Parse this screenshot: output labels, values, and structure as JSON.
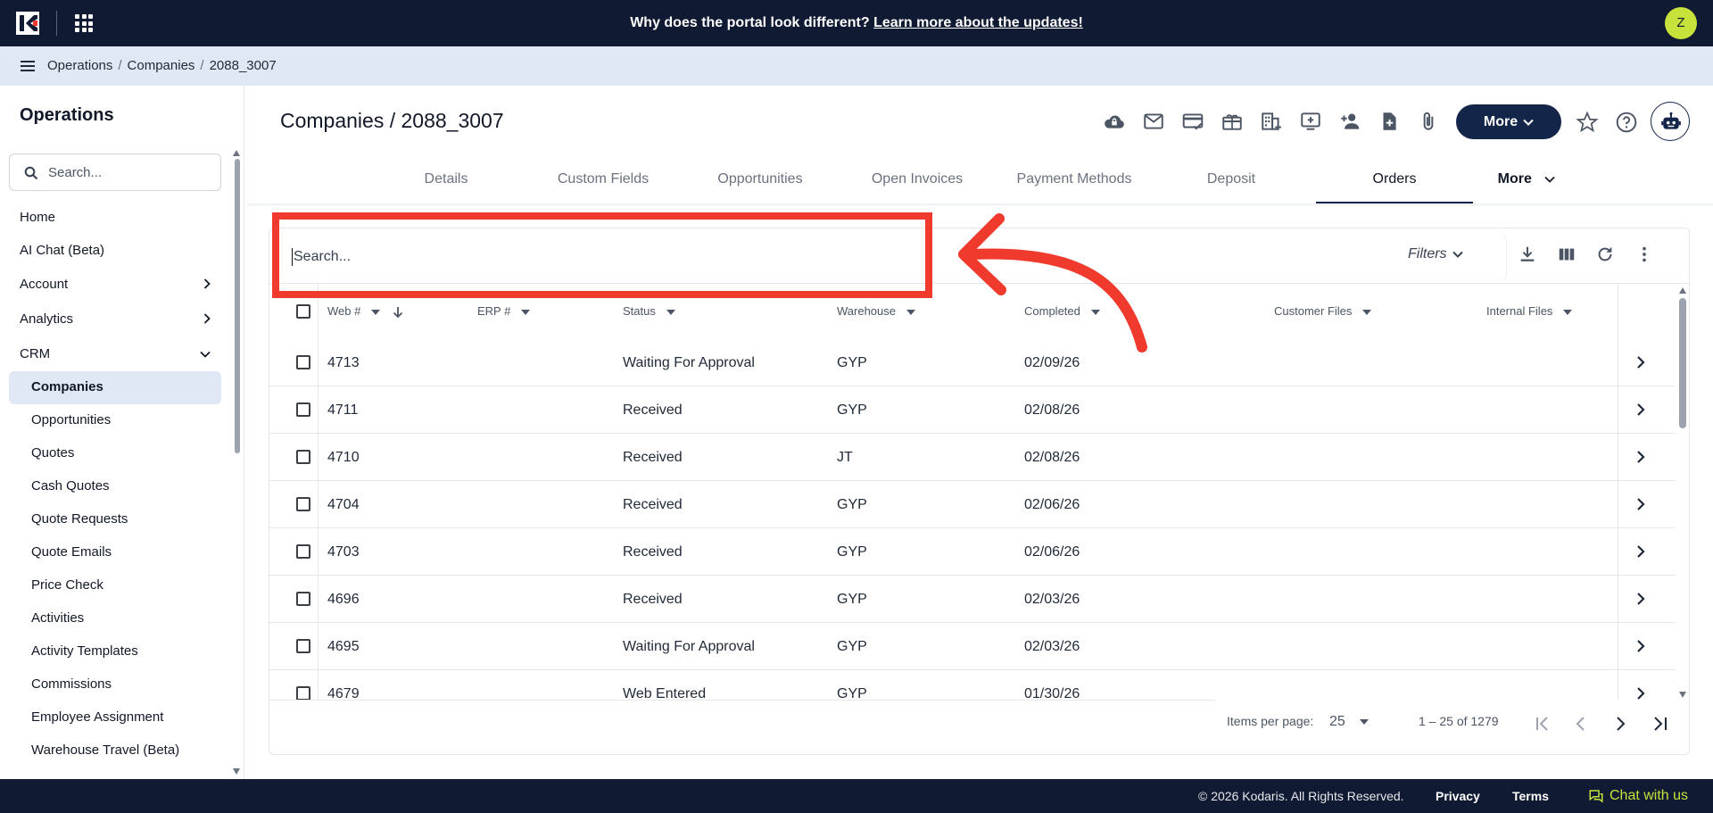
{
  "banner": {
    "question": "Why does the portal look different?",
    "link": "Learn more about the updates!"
  },
  "user": {
    "initial": "Z"
  },
  "breadcrumb": [
    "Operations",
    "Companies",
    "2088_3007"
  ],
  "sidebar": {
    "title": "Operations",
    "search_placeholder": "Search...",
    "items": [
      {
        "label": "Home"
      },
      {
        "label": "AI Chat (Beta)"
      },
      {
        "label": "Account",
        "chevron": "right"
      },
      {
        "label": "Analytics",
        "chevron": "right"
      },
      {
        "label": "CRM",
        "chevron": "down"
      }
    ],
    "crm_items": [
      {
        "label": "Companies",
        "active": true
      },
      {
        "label": "Opportunities"
      },
      {
        "label": "Quotes"
      },
      {
        "label": "Cash Quotes"
      },
      {
        "label": "Quote Requests"
      },
      {
        "label": "Quote Emails"
      },
      {
        "label": "Price Check"
      },
      {
        "label": "Activities"
      },
      {
        "label": "Activity Templates"
      },
      {
        "label": "Commissions"
      },
      {
        "label": "Employee Assignment"
      },
      {
        "label": "Warehouse Travel (Beta)"
      }
    ]
  },
  "page": {
    "title": "Companies / 2088_3007",
    "more_label": "More",
    "toolbar_icons": [
      "cloud-lock-icon",
      "mail-icon",
      "credit-card-check-icon",
      "gift-card-icon",
      "building-icon",
      "add-screen-icon",
      "add-person-icon",
      "add-file-icon",
      "paperclip-icon"
    ]
  },
  "tabs": [
    {
      "label": "Details"
    },
    {
      "label": "Custom Fields"
    },
    {
      "label": "Opportunities"
    },
    {
      "label": "Open Invoices"
    },
    {
      "label": "Payment Methods"
    },
    {
      "label": "Deposit"
    },
    {
      "label": "Orders",
      "active": true
    },
    {
      "label": "More"
    }
  ],
  "table": {
    "search_placeholder": "Search...",
    "filters_label": "Filters",
    "columns": [
      "Web #",
      "ERP #",
      "Status",
      "Warehouse",
      "Completed",
      "Customer Files",
      "Internal Files"
    ],
    "rows": [
      {
        "web": "4713",
        "erp": "",
        "status": "Waiting For Approval",
        "warehouse": "GYP",
        "completed": "02/09/26"
      },
      {
        "web": "4711",
        "erp": "",
        "status": "Received",
        "warehouse": "GYP",
        "completed": "02/08/26"
      },
      {
        "web": "4710",
        "erp": "",
        "status": "Received",
        "warehouse": "JT",
        "completed": "02/08/26"
      },
      {
        "web": "4704",
        "erp": "",
        "status": "Received",
        "warehouse": "GYP",
        "completed": "02/06/26"
      },
      {
        "web": "4703",
        "erp": "",
        "status": "Received",
        "warehouse": "GYP",
        "completed": "02/06/26"
      },
      {
        "web": "4696",
        "erp": "",
        "status": "Received",
        "warehouse": "GYP",
        "completed": "02/03/26"
      },
      {
        "web": "4695",
        "erp": "",
        "status": "Waiting For Approval",
        "warehouse": "GYP",
        "completed": "02/03/26"
      },
      {
        "web": "4679",
        "erp": "",
        "status": "Web Entered",
        "warehouse": "GYP",
        "completed": "01/30/26"
      }
    ],
    "pagination": {
      "items_per_page_label": "Items per page:",
      "page_size": "25",
      "range": "1 – 25 of 1279"
    }
  },
  "footer": {
    "copyright": "© 2026 Kodaris. All Rights Reserved.",
    "privacy": "Privacy",
    "terms": "Terms",
    "chat": "Chat with us"
  },
  "colors": {
    "navy": "#101b33",
    "accent_lime": "#c6e23b",
    "annotation_red": "#f03a2e",
    "active_bg": "#e1e8f5"
  }
}
